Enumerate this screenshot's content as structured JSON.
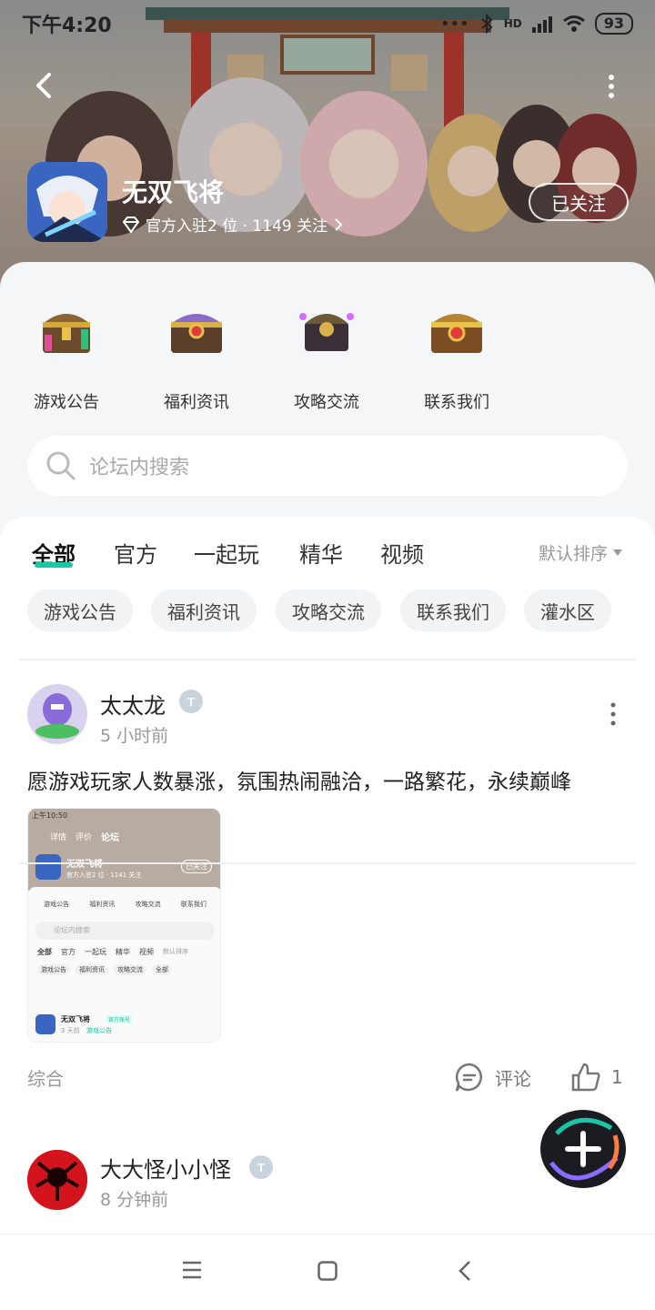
{
  "status_bar": {
    "time": "下午4:20",
    "network": "HD",
    "battery": "93"
  },
  "header": {
    "game_title": "无双飞将",
    "meta_text": "官方入驻2 位 · 1149 关注",
    "follow_label": "已关注"
  },
  "categories": [
    {
      "label": "游戏公告",
      "icon": "chest-gold-icon"
    },
    {
      "label": "福利资讯",
      "icon": "chest-purple-icon"
    },
    {
      "label": "攻略交流",
      "icon": "chest-guide-icon"
    },
    {
      "label": "联系我们",
      "icon": "chest-contact-icon"
    }
  ],
  "search": {
    "placeholder": "论坛内搜索"
  },
  "tabs": [
    {
      "label": "全部",
      "active": true
    },
    {
      "label": "官方"
    },
    {
      "label": "一起玩"
    },
    {
      "label": "精华"
    },
    {
      "label": "视频"
    }
  ],
  "sort_label": "默认排序",
  "chips": [
    "游戏公告",
    "福利资讯",
    "攻略交流",
    "联系我们",
    "灌水区"
  ],
  "post": {
    "author": "太太龙",
    "time": "5 小时前",
    "text": "愿游戏玩家人数暴涨，氛围热闹融洽，一路繁花，永续巅峰",
    "tag": "综合",
    "comment_label": "评论",
    "like_count": "1",
    "screenshot": {
      "status_time": "上午10:50",
      "tabs": [
        "详情",
        "评价",
        "论坛"
      ],
      "title": "无双飞将",
      "meta": "官方入驻2 位 · 1141 关注",
      "follow": "已关注",
      "cats": [
        "游戏公告",
        "福利资讯",
        "攻略交流",
        "联系我们"
      ],
      "search": "论坛内搜索",
      "feed_tabs": [
        "全部",
        "官方",
        "一起玩",
        "精华",
        "视频"
      ],
      "sort": "默认排序",
      "chips": [
        "游戏公告",
        "福利资讯",
        "攻略交流",
        "全部"
      ],
      "post_title": "无双飞将",
      "post_badge": "官方账号",
      "post_time": "3 天前",
      "post_tag": "游戏公告"
    }
  },
  "post2": {
    "author": "大大怪小小怪",
    "time": "8 分钟前"
  },
  "colors": {
    "accent": "#18c7a6",
    "panel_bg": "#f5f6f8"
  }
}
